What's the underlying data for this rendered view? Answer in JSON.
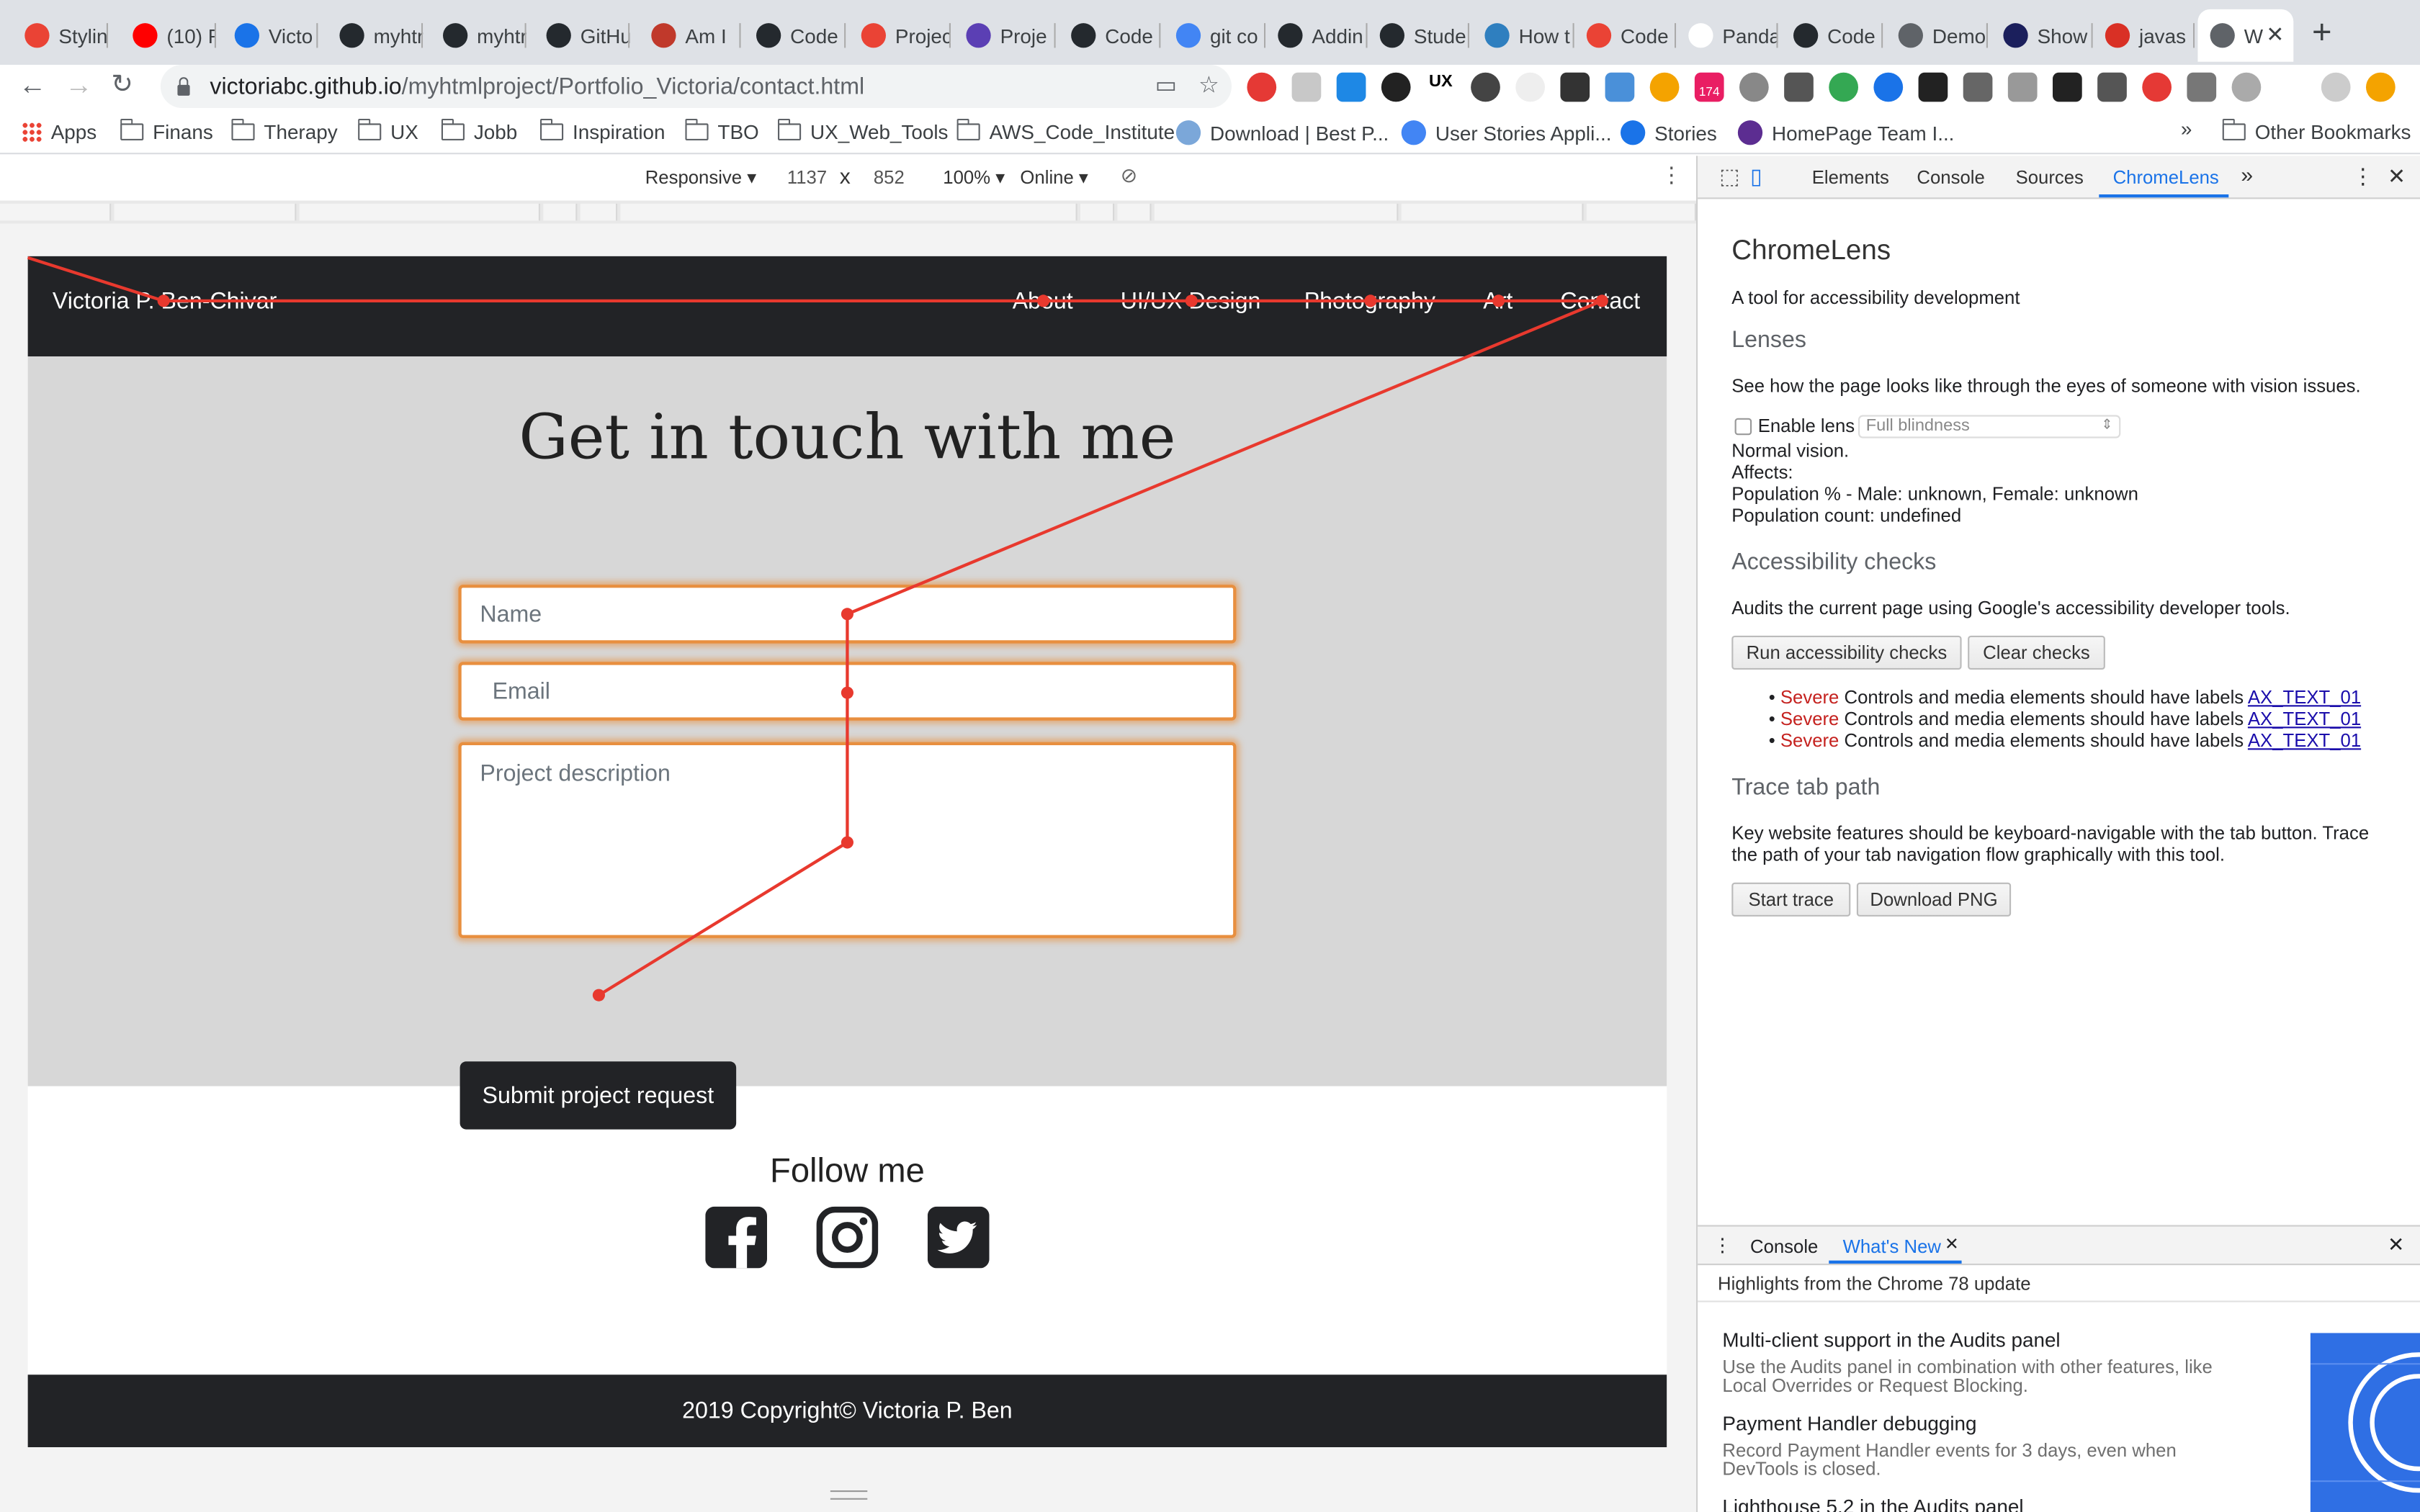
{
  "browser": {
    "tabs": [
      {
        "title": "Stylin",
        "color": "#ea4335"
      },
      {
        "title": "(10) R",
        "color": "#ff0000"
      },
      {
        "title": "Victo",
        "color": "#1a73e8"
      },
      {
        "title": "myhtr",
        "color": "#24292e"
      },
      {
        "title": "myhtr",
        "color": "#24292e"
      },
      {
        "title": "GitHu",
        "color": "#24292e"
      },
      {
        "title": "Am I",
        "color": "#c0392b"
      },
      {
        "title": "Code",
        "color": "#24292e"
      },
      {
        "title": "Projec",
        "color": "#ea4335"
      },
      {
        "title": "Proje",
        "color": "#5b3fb4"
      },
      {
        "title": "Code",
        "color": "#24292e"
      },
      {
        "title": "git co",
        "color": "#4285f4"
      },
      {
        "title": "Addin",
        "color": "#24292e"
      },
      {
        "title": "Stude",
        "color": "#24292e"
      },
      {
        "title": "How t",
        "color": "#2f7fbf"
      },
      {
        "title": "Code",
        "color": "#ea4335"
      },
      {
        "title": "Panda",
        "color": "#ffffff"
      },
      {
        "title": "Code",
        "color": "#24292e"
      },
      {
        "title": "Demo",
        "color": "#5f6368"
      },
      {
        "title": "Show",
        "color": "#1b1f5c"
      },
      {
        "title": "javas",
        "color": "#d93025"
      },
      {
        "title": "W",
        "color": "#5f6368"
      }
    ],
    "new_tab_label": "+",
    "close_label": "✕",
    "url_host": "victoriabc.github.io",
    "url_path": "/myhtmlproject/Portfolio_Victoria/contact.html",
    "ext_badge": "174",
    "bookmarks": [
      "Apps",
      "Finans",
      "Therapy",
      "UX",
      "Jobb",
      "Inspiration",
      "TBO",
      "UX_Web_Tools",
      "AWS_Code_Institute",
      "Download | Best P...",
      "User Stories Appli...",
      "Stories",
      "HomePage Team I..."
    ],
    "bookmarks_overflow": "»",
    "other_bookmarks": "Other Bookmarks"
  },
  "device_toolbar": {
    "mode": "Responsive ▾",
    "width": "1137",
    "times": "x",
    "height": "852",
    "zoom": "100% ▾",
    "network": "Online ▾"
  },
  "site": {
    "brand": "Victoria P. Ben-Chivar",
    "nav": [
      "About",
      "UI/UX Design",
      "Photography",
      "Art",
      "Contact"
    ],
    "heading": "Get in touch with me",
    "name_placeholder": "Name",
    "email_placeholder": "Email",
    "description_placeholder": "Project description",
    "submit_label": "Submit project request",
    "follow_label": "Follow me",
    "social_icons": [
      "facebook-icon",
      "instagram-icon",
      "twitter-icon"
    ],
    "footer": "2019 Copyright© Victoria P. Ben"
  },
  "devtools": {
    "tabs": [
      "Elements",
      "Console",
      "Sources",
      "ChromeLens"
    ],
    "active_tab": "ChromeLens",
    "more": "»",
    "title": "ChromeLens",
    "subtitle": "A tool for accessibility development",
    "lenses_heading": "Lenses",
    "lenses_desc": "See how the page looks like through the eyes of someone with vision issues.",
    "enable_lens_label": "Enable lens",
    "lens_select": "Full blindness",
    "lens_status": [
      "Normal vision.",
      "Affects:",
      "Population % - Male: unknown, Female: unknown",
      "Population count: undefined"
    ],
    "checks_heading": "Accessibility checks",
    "checks_desc": "Audits the current page using Google's accessibility developer tools.",
    "run_checks_label": "Run accessibility checks",
    "clear_checks_label": "Clear checks",
    "issues": [
      {
        "severity": "Severe",
        "text": "Controls and media elements should have labels",
        "code": "AX_TEXT_01"
      },
      {
        "severity": "Severe",
        "text": "Controls and media elements should have labels",
        "code": "AX_TEXT_01"
      },
      {
        "severity": "Severe",
        "text": "Controls and media elements should have labels",
        "code": "AX_TEXT_01"
      }
    ],
    "trace_heading": "Trace tab path",
    "trace_desc": "Key website features should be keyboard-navigable with the tab button. Trace the path of your tab navigation flow graphically with this tool.",
    "start_trace_label": "Start trace",
    "download_png_label": "Download PNG",
    "drawer_tabs": [
      "Console",
      "What's New"
    ],
    "drawer_highlights": "Highlights from the Chrome 78 update",
    "whats_new": [
      {
        "title": "Multi-client support in the Audits panel",
        "desc": "Use the Audits panel in combination with other features, like Local Overrides or Request Blocking."
      },
      {
        "title": "Payment Handler debugging",
        "desc": "Record Payment Handler events for 3 days, even when DevTools is closed."
      },
      {
        "title": "Lighthouse 5.2 in the Audits panel",
        "desc": ""
      }
    ]
  }
}
